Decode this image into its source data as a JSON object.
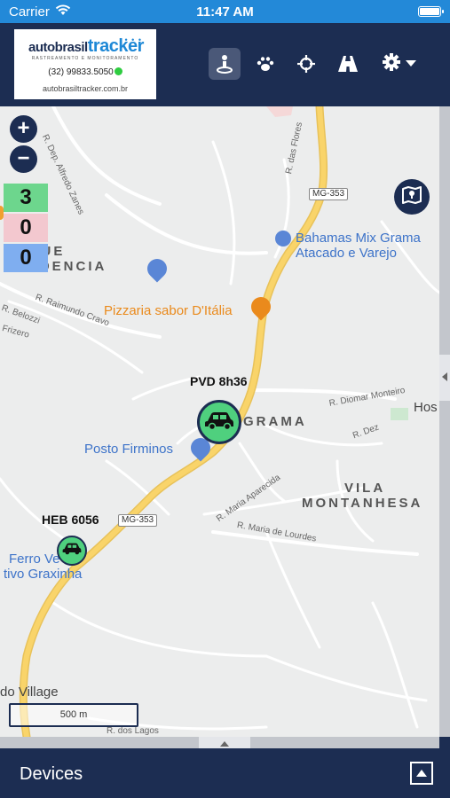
{
  "status_bar": {
    "carrier": "Carrier",
    "time": "11:47 AM"
  },
  "header": {
    "logo": {
      "brand_left": "autobrasil",
      "brand_right": "tracker",
      "tagline": "RASTREAMENTO E MONITORAMENTO",
      "phone": "(32) 99833.5050",
      "website": "autobrasiltracker.com.br"
    },
    "toolbar_icons": [
      "person-location-icon",
      "paw-icon",
      "crosshair-icon",
      "road-icon",
      "gear-icon"
    ]
  },
  "map": {
    "zoom_in": "+",
    "zoom_out": "−",
    "counters": {
      "green": "3",
      "pink": "0",
      "blue": "0"
    },
    "labels": {
      "bahamas_line1": "Bahamas Mix Grama",
      "bahamas_line2": "Atacado e Varejo",
      "pizzaria": "Pizzaria sabor D'Itália",
      "posto": "Posto Firminos",
      "grama": "GRAMA",
      "vila_line1": "VILA",
      "vila_line2": "MONTANHESA",
      "parque_line1": "RQUE",
      "parque_line2": "ENDENCIA",
      "ferro_line1": "Ferro Ve",
      "ferro_line2": "tivo Graxinha",
      "village": "do Village",
      "hos": "Hos",
      "mg353_top": "MG-353",
      "mg353_bottom": "MG-353"
    },
    "streets": {
      "dep_alfredo": "R. Dep. Alfredo Zanes",
      "das_flores": "R. das Flores",
      "raimundo": "R. Raimundo Cravo",
      "belozzi": "R. Belozzi",
      "frizero": "Frizero",
      "diomar": "R. Diomar Monteiro",
      "dez": "R. Dez",
      "maria_aparecida": "R. Maria Aparecida",
      "maria_lourdes": "R. Maria de Lourdes",
      "dos_lagos": "R. dos Lagos"
    },
    "vehicles": [
      {
        "label": "PVD 8h36"
      },
      {
        "label": "HEB 6056"
      }
    ],
    "scale": "500 m"
  },
  "footer": {
    "title": "Devices"
  },
  "colors": {
    "navy": "#1c2d52",
    "status_blue": "#2389d8",
    "vehicle_green": "#4fd07e",
    "road_yellow": "#f9d46a"
  }
}
